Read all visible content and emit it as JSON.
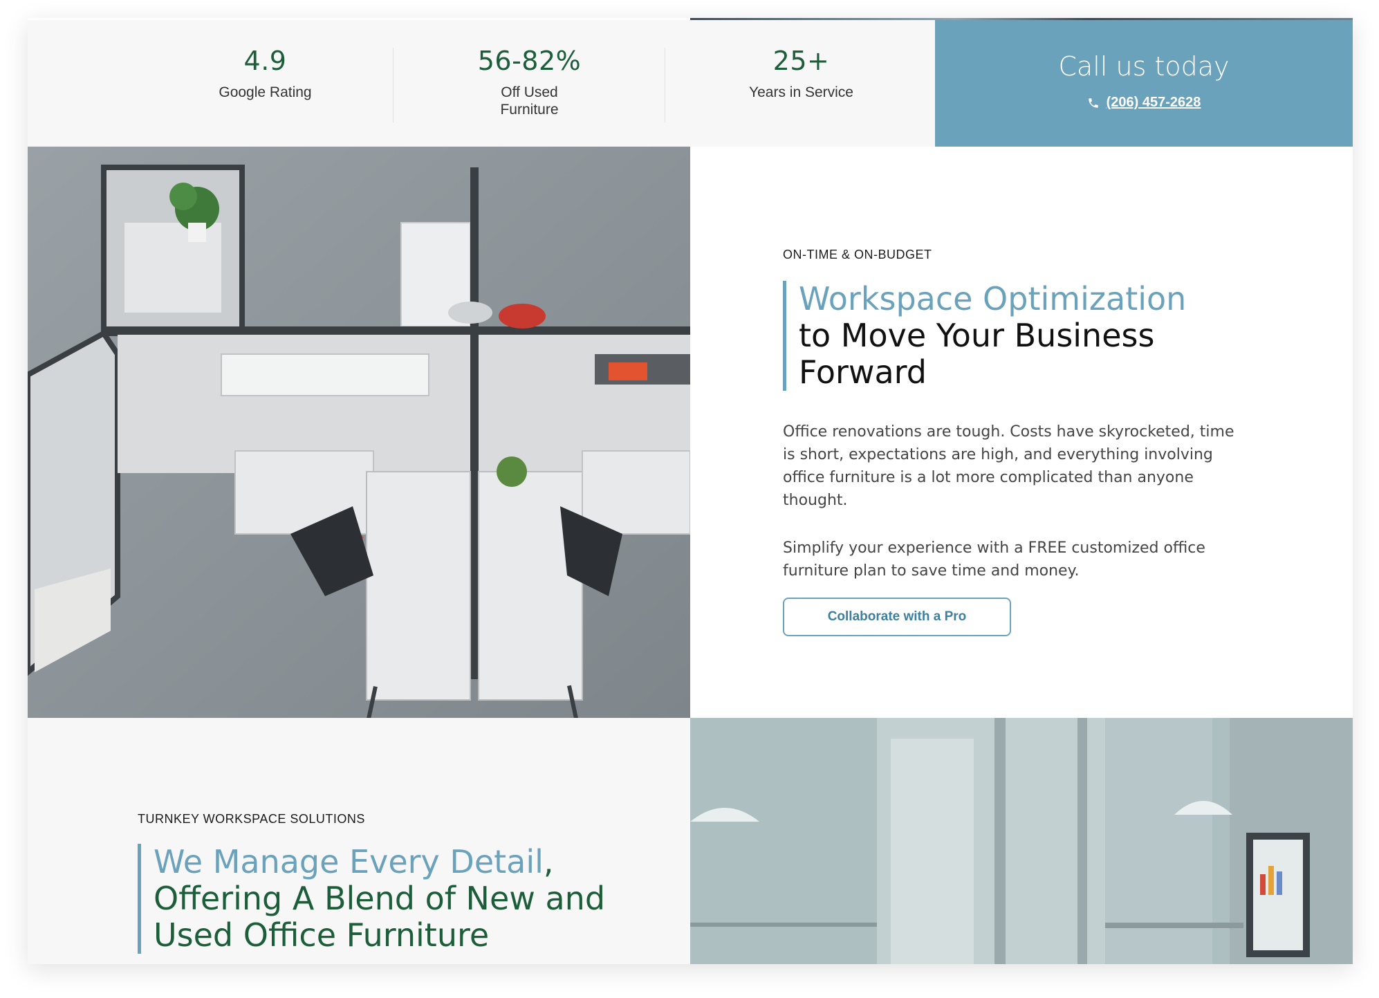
{
  "stats": [
    {
      "value": "4.9",
      "label": "Google Rating"
    },
    {
      "value": "56-82%",
      "label": "Off Used Furniture"
    },
    {
      "value": "25+",
      "label": "Years in Service"
    }
  ],
  "call": {
    "title": "Call us today",
    "phone": "(206) 457-2628",
    "icon": "phone-icon"
  },
  "feature_1": {
    "eyebrow": "ON-TIME & ON-BUDGET",
    "heading_accent": "Workspace Optimization",
    "heading_rest": "to Move Your Business Forward",
    "paragraph_1": "Office renovations are tough. Costs have skyrocketed, time is short, expectations are high, and everything involving office furniture is a lot more complicated than anyone thought.",
    "paragraph_2": "Simplify your experience with a FREE customized office furniture plan to save time and money.",
    "button_label": "Collaborate with a Pro"
  },
  "feature_2": {
    "eyebrow": "TURNKEY WORKSPACE SOLUTIONS",
    "heading_accent": "We Manage Every Detail",
    "heading_comma": ",",
    "heading_rest": "Offering A Blend of New and Used Office Furniture"
  },
  "colors": {
    "accent_blue": "#6aa2bc",
    "brand_green": "#1d5e3a"
  }
}
